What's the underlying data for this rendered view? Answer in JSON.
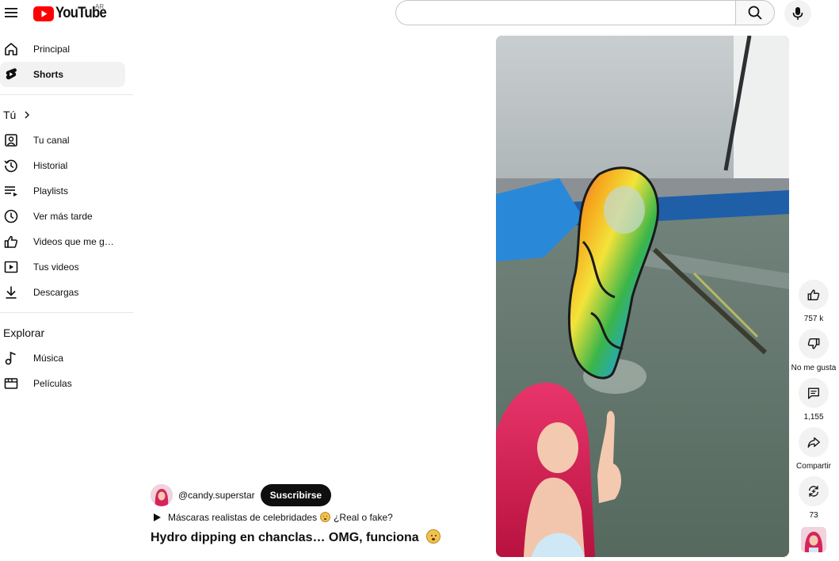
{
  "header": {
    "logo_text": "YouTube",
    "country_code": "AR",
    "search_placeholder": "",
    "search_value": ""
  },
  "sidebar": {
    "primary": [
      {
        "label": "Principal",
        "icon": "home-icon"
      },
      {
        "label": "Shorts",
        "icon": "shorts-icon",
        "active": true
      }
    ],
    "you_title": "Tú",
    "you_items": [
      {
        "label": "Tu canal",
        "icon": "channel-icon"
      },
      {
        "label": "Historial",
        "icon": "history-icon"
      },
      {
        "label": "Playlists",
        "icon": "playlists-icon"
      },
      {
        "label": "Ver más tarde",
        "icon": "watch-later-icon"
      },
      {
        "label": "Videos que me gus…",
        "icon": "liked-videos-icon"
      },
      {
        "label": "Tus videos",
        "icon": "your-videos-icon"
      },
      {
        "label": "Descargas",
        "icon": "downloads-icon"
      }
    ],
    "explore_title": "Explorar",
    "explore_items": [
      {
        "label": "Música",
        "icon": "music-icon"
      },
      {
        "label": "Películas",
        "icon": "movies-icon"
      }
    ]
  },
  "short": {
    "channel_handle": "@candy.superstar",
    "subscribe_label": "Suscribirse",
    "playlist_text_a": "Máscaras realistas de celebridades",
    "playlist_text_b": "¿Real o fake?",
    "title": "Hydro dipping en chanclas… OMG, funciona"
  },
  "actions": {
    "like_count": "757 k",
    "dislike_label": "No me gusta",
    "comment_count": "1,155",
    "share_label": "Compartir",
    "remix_count": "73"
  },
  "colors": {
    "brand_red": "#ff0000",
    "subscribe_bg": "#0f0f0f",
    "active_bg": "#f2f2f2"
  }
}
